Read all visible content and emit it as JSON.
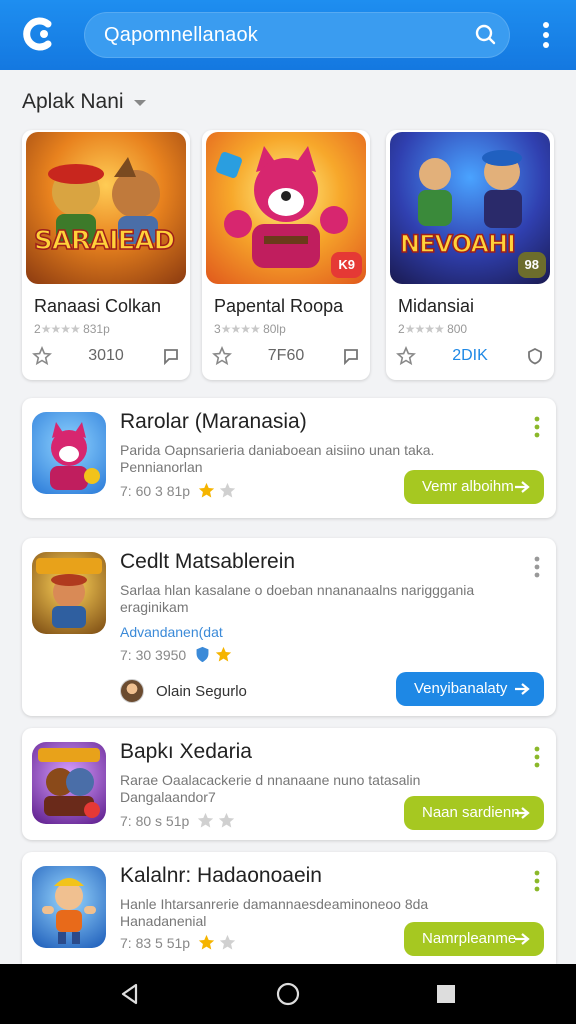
{
  "header": {
    "search_text": "Qapomnellanaok"
  },
  "section": {
    "title": "Aplak Nani"
  },
  "featured": [
    {
      "art_text": "SARAIEAD",
      "name": "Ranaasi Colkan",
      "meta_prefix": "2",
      "meta_suffix": "831p",
      "count": "3010",
      "badge": "",
      "badge_color": ""
    },
    {
      "art_text": "",
      "name": "Papental Roopa",
      "meta_prefix": "3",
      "meta_suffix": "80lp",
      "count": "7F60",
      "badge": "K9",
      "badge_color": "#e53935"
    },
    {
      "art_text": "NEVOAHI",
      "name": "Midansiai",
      "meta_prefix": "2",
      "meta_suffix": "800",
      "count": "2DIK",
      "badge": "98",
      "badge_color": "#6d6d2c"
    }
  ],
  "list": [
    {
      "title": "Rarolar (Maranasia)",
      "desc": "Parida Oapnsarieria daniaboean aisiino unan taka.",
      "desc2": "Pennianorlan",
      "rating": "7: 60 3 81p",
      "button": "Vemr alboihm",
      "button_color": "green"
    },
    {
      "title": "Cedlt Matsablerein",
      "desc": "Sarlaa hlan kasalane o doeban nnananaalns narigggania",
      "desc2": "eraginikam",
      "link": "Advandanen(dat",
      "rating": "7: 30 3950",
      "developer": "Olain Segurlo",
      "button": "Venyibanalaty",
      "button_color": "blue"
    },
    {
      "title": "Bapkı Xedaria",
      "desc": "Rarae Oaalacackerie d nnanaane nuno tatasalin",
      "desc2": "Dangalaandor7",
      "rating": "7: 80 s 51p",
      "button": "Naan sardienn",
      "button_color": "green"
    },
    {
      "title": "Kalalnr: Hadaonoaein",
      "desc": "Hanle Ihtarsanrerie damannaesdeaminoneoo 8da",
      "desc2": "Hanadanenial",
      "rating": "7: 83 5 51p",
      "button": "Namrpleanme",
      "button_color": "green"
    }
  ],
  "colors": {
    "topbar": "#1e8ef0",
    "green_button": "#a6c821",
    "blue_button": "#1e88e5",
    "star": "#f5b400"
  },
  "icons": [
    "app-logo-icon",
    "search-icon",
    "more-vert-icon",
    "chevron-down-icon",
    "star-outline-icon",
    "bookmark-icon",
    "shield-icon",
    "back-icon",
    "home-icon",
    "recents-icon"
  ]
}
